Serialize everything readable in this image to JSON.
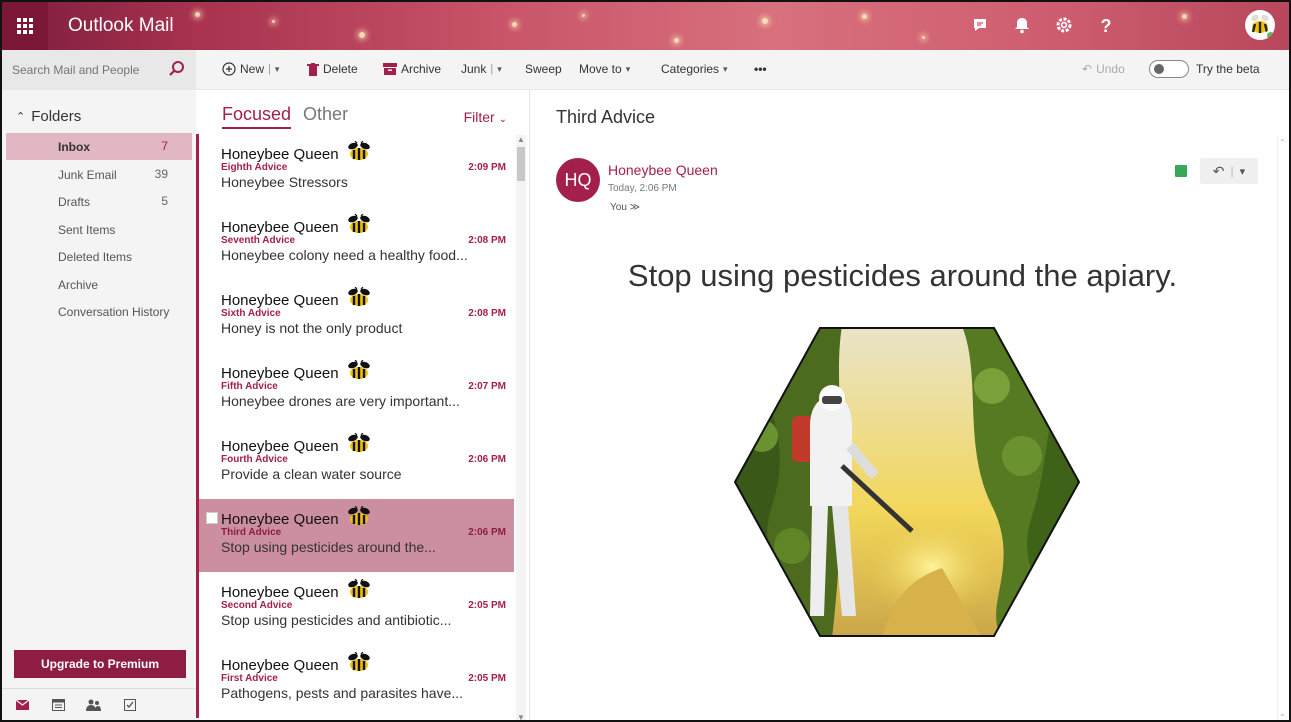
{
  "app": {
    "title": "Outlook Mail"
  },
  "topbar": {
    "icons": [
      "skype-icon",
      "bell-icon",
      "gear-icon",
      "help-icon",
      "avatar"
    ],
    "help_label": "?"
  },
  "search": {
    "placeholder": "Search Mail and People"
  },
  "commands": {
    "new": "New",
    "delete": "Delete",
    "archive": "Archive",
    "junk": "Junk",
    "sweep": "Sweep",
    "move_to": "Move to",
    "categories": "Categories",
    "more": "•••",
    "undo": "Undo",
    "try_beta": "Try the beta"
  },
  "folders": {
    "header": "Folders",
    "items": [
      {
        "label": "Inbox",
        "count": "7"
      },
      {
        "label": "Junk Email",
        "count": "39"
      },
      {
        "label": "Drafts",
        "count": "5"
      },
      {
        "label": "Sent Items",
        "count": ""
      },
      {
        "label": "Deleted Items",
        "count": ""
      },
      {
        "label": "Archive",
        "count": ""
      },
      {
        "label": "Conversation History",
        "count": ""
      }
    ],
    "upgrade_label": "Upgrade to Premium"
  },
  "list": {
    "tab_focused": "Focused",
    "tab_other": "Other",
    "filter": "Filter",
    "messages": [
      {
        "sender": "Honeybee Queen",
        "subject": "Eighth Advice",
        "time": "2:09 PM",
        "preview": "Honeybee Stressors"
      },
      {
        "sender": "Honeybee Queen",
        "subject": "Seventh Advice",
        "time": "2:08 PM",
        "preview": "Honeybee colony need a healthy food..."
      },
      {
        "sender": "Honeybee Queen",
        "subject": "Sixth Advice",
        "time": "2:08 PM",
        "preview": "Honey is not the only product"
      },
      {
        "sender": "Honeybee Queen",
        "subject": "Fifth Advice",
        "time": "2:07 PM",
        "preview": "Honeybee drones are very important..."
      },
      {
        "sender": "Honeybee Queen",
        "subject": "Fourth Advice",
        "time": "2:06 PM",
        "preview": "Provide a clean water source"
      },
      {
        "sender": "Honeybee Queen",
        "subject": "Third Advice",
        "time": "2:06 PM",
        "preview": "Stop using pesticides around the..."
      },
      {
        "sender": "Honeybee Queen",
        "subject": "Second Advice",
        "time": "2:05 PM",
        "preview": "Stop using pesticides and antibiotic..."
      },
      {
        "sender": "Honeybee Queen",
        "subject": "First Advice",
        "time": "2:05 PM",
        "preview": "Pathogens, pests and parasites have..."
      }
    ],
    "selected_index": 5
  },
  "reading": {
    "subject": "Third Advice",
    "avatar_initials": "HQ",
    "sender": "Honeybee Queen",
    "time": "Today, 2:06 PM",
    "to": "You ≫",
    "body": "Stop using pesticides around the apiary."
  },
  "colors": {
    "accent": "#a3204c",
    "selected_row": "#cc8fa0",
    "active_folder": "#e0b7c2",
    "upgrade_button": "#8e1d43"
  }
}
